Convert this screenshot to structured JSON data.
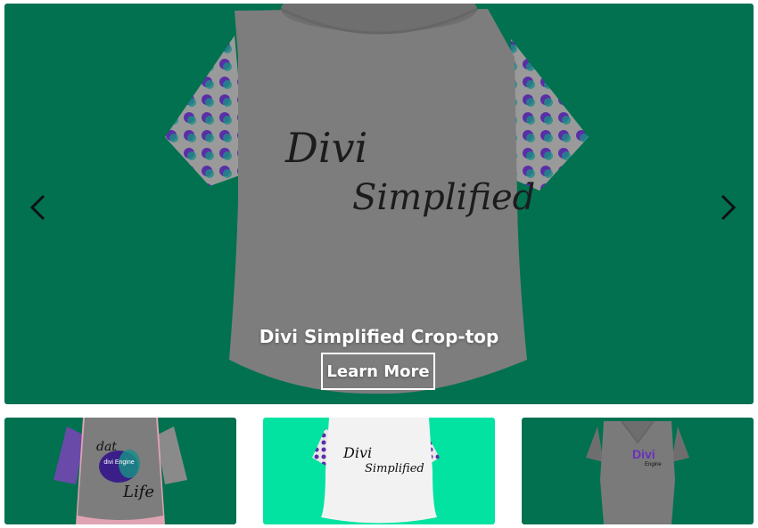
{
  "colors": {
    "slide_bg": "#017150",
    "thumb_active_bg": "#02e3a1",
    "shirt_gray": "#7d7d7d",
    "shirt_white": "#f2f2f2",
    "pattern_purple": "#5a2ea6",
    "pattern_teal": "#1b8d86"
  },
  "slider": {
    "active_index": 1,
    "slide": {
      "title": "Divi Simplified Crop-top",
      "button_label": "Learn More",
      "shirt_print_line1": "Divi",
      "shirt_print_line2": "Simplified"
    },
    "prev_icon": "chevron-left-icon",
    "next_icon": "chevron-right-icon"
  },
  "thumbnails": [
    {
      "print_top": "dat",
      "print_badge": "divi Engine",
      "print_bottom": "Life"
    },
    {
      "print_line1": "Divi",
      "print_line2": "Simplified"
    },
    {
      "print_brand": "Divi",
      "print_small": "Engine"
    }
  ]
}
